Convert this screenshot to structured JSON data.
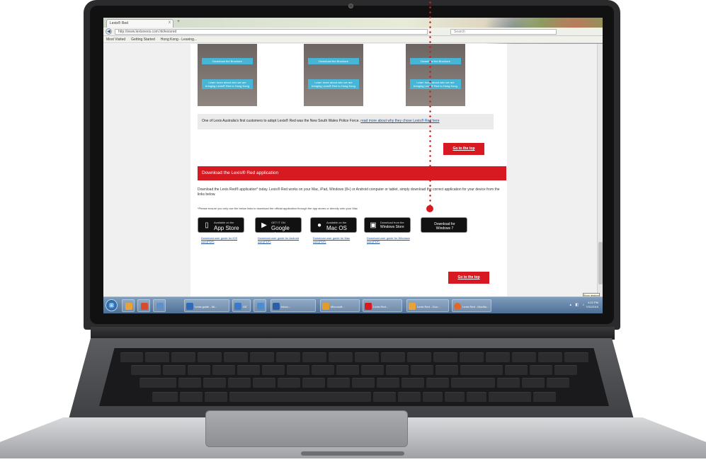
{
  "browser": {
    "tab_title": "Lexis® Red",
    "tab_close": "x",
    "new_tab": "+",
    "back": "◀",
    "url": "http://www.lexisnexis.com.hk/lexisred",
    "search_placeholder": "Search",
    "bookmarks": [
      "Most Visited",
      "Getting Started",
      "Hong Kong - Leaving..."
    ]
  },
  "promos": [
    {
      "download_label": "Download the Brochure",
      "learn_label": "Learn more about who we are bringing Lexis® Red to Hong Kong"
    },
    {
      "download_label": "Download the Brochure",
      "learn_label": "Learn more about who we are bringing Lexis® Red to Hong Kong"
    },
    {
      "download_label": "Download the Brochure",
      "learn_label": "Learn more about who we are bringing Lexis® Red to Hong Kong"
    }
  ],
  "quote": {
    "text": "One of Lexis Australia's first customers to adopt Lexis® Red was the New South Wales Police Force.",
    "link": "read more about why they chose Lexis® Red here"
  },
  "go_to_top": "Go to the top",
  "download_section": {
    "title": "Download the Lexis® Red application",
    "intro": "Download the Lexis Red® application* today. Lexis® Red works on your Mac, iPad, Windows (8+) or Android computer or tablet, simply download the correct application for your device from the links below.",
    "note": "*Please ensure you only use the below links to download the official application through the app stores or directly onto your Mac"
  },
  "stores": [
    {
      "small": "Available on the",
      "big": "App Store",
      "icon": "phone-icon",
      "glyph": "▯",
      "guide": "Download user guide for iOS user(PDF)"
    },
    {
      "small": "GET IT ON",
      "big": "Google play",
      "icon": "play-icon",
      "glyph": "▶",
      "guide": "Download user guide for Android user(PDF)"
    },
    {
      "small": "Available on the",
      "big": "Mac OS",
      "icon": "apple-icon",
      "glyph": "●",
      "guide": "Download user guide for Mac user(PDF)"
    },
    {
      "small": "Download from the",
      "big": "Windows Store",
      "icon": "windows-store-icon",
      "glyph": "▣",
      "guide": "Download user guide for Windows user(PDF)"
    },
    {
      "small": "Download for",
      "big": "Windows 7",
      "icon": "",
      "glyph": "",
      "guide": ""
    }
  ],
  "taskbar": {
    "start_glyph": "⊞",
    "items": [
      {
        "label": "",
        "color": "#e8a23a"
      },
      {
        "label": "",
        "color": "#d94a2a"
      },
      {
        "label": "",
        "color": "#5f8fc8"
      },
      {
        "label": "Lexis guide - Mi...",
        "color": "#2e6ab8"
      },
      {
        "label": "OE",
        "color": "#3a78c8"
      },
      {
        "label": "",
        "color": "#4a8ed0"
      },
      {
        "label": "Inbox...",
        "color": "#2b5fa5"
      },
      {
        "label": "Microsoft...",
        "color": "#e49b2c"
      },
      {
        "label": "Lexis Red...",
        "color": "#d71921"
      },
      {
        "label": "Lexis Red - Goo...",
        "color": "#e8a23a"
      },
      {
        "label": "Lexis Red - Mozilla...",
        "color": "#e0672a"
      }
    ],
    "time": "4:22 PM",
    "date": "7/31/2015",
    "tray": "▴ ◧ ♪",
    "tooltip": "Show desktop"
  },
  "accent_color": "#d71921",
  "link_color": "#1a4fa0"
}
